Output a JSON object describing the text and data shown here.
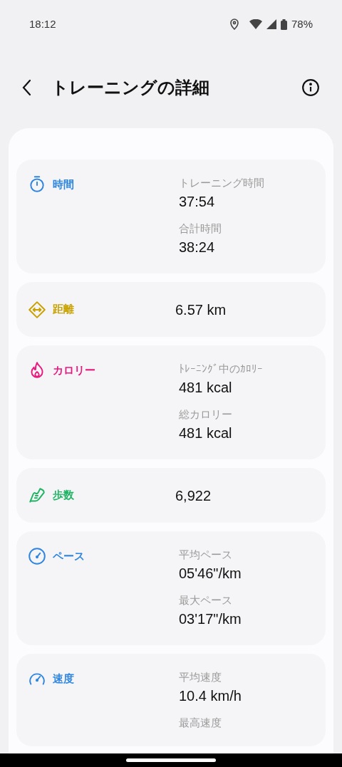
{
  "status_bar": {
    "time": "18:12",
    "battery": "78%"
  },
  "header": {
    "title": "トレーニングの詳細"
  },
  "cards": [
    {
      "color": "#2f86e0",
      "title": "時間",
      "kind": "multi",
      "items": [
        {
          "label": "トレーニング時間",
          "value": "37:54"
        },
        {
          "label": "合計時間",
          "value": "38:24"
        }
      ]
    },
    {
      "color": "#c9a100",
      "title": "距離",
      "kind": "single",
      "value": "6.57 km"
    },
    {
      "color": "#e8197d",
      "title": "カロリー",
      "kind": "multi",
      "items": [
        {
          "label": "ﾄﾚｰﾆﾝｸﾞ中のｶﾛﾘｰ",
          "value": "481 kcal"
        },
        {
          "label": "総カロリー",
          "value": "481 kcal"
        }
      ]
    },
    {
      "color": "#1fb364",
      "title": "歩数",
      "kind": "single",
      "value": "6,922"
    },
    {
      "color": "#2f86e0",
      "title": "ペース",
      "kind": "multi",
      "items": [
        {
          "label": "平均ペース",
          "value": "05'46\"/km"
        },
        {
          "label": "最大ペース",
          "value": "03'17\"/km"
        }
      ]
    },
    {
      "color": "#2f86e0",
      "title": "速度",
      "kind": "multi",
      "items": [
        {
          "label": "平均速度",
          "value": "10.4 km/h"
        },
        {
          "label": "最高速度"
        }
      ]
    }
  ]
}
